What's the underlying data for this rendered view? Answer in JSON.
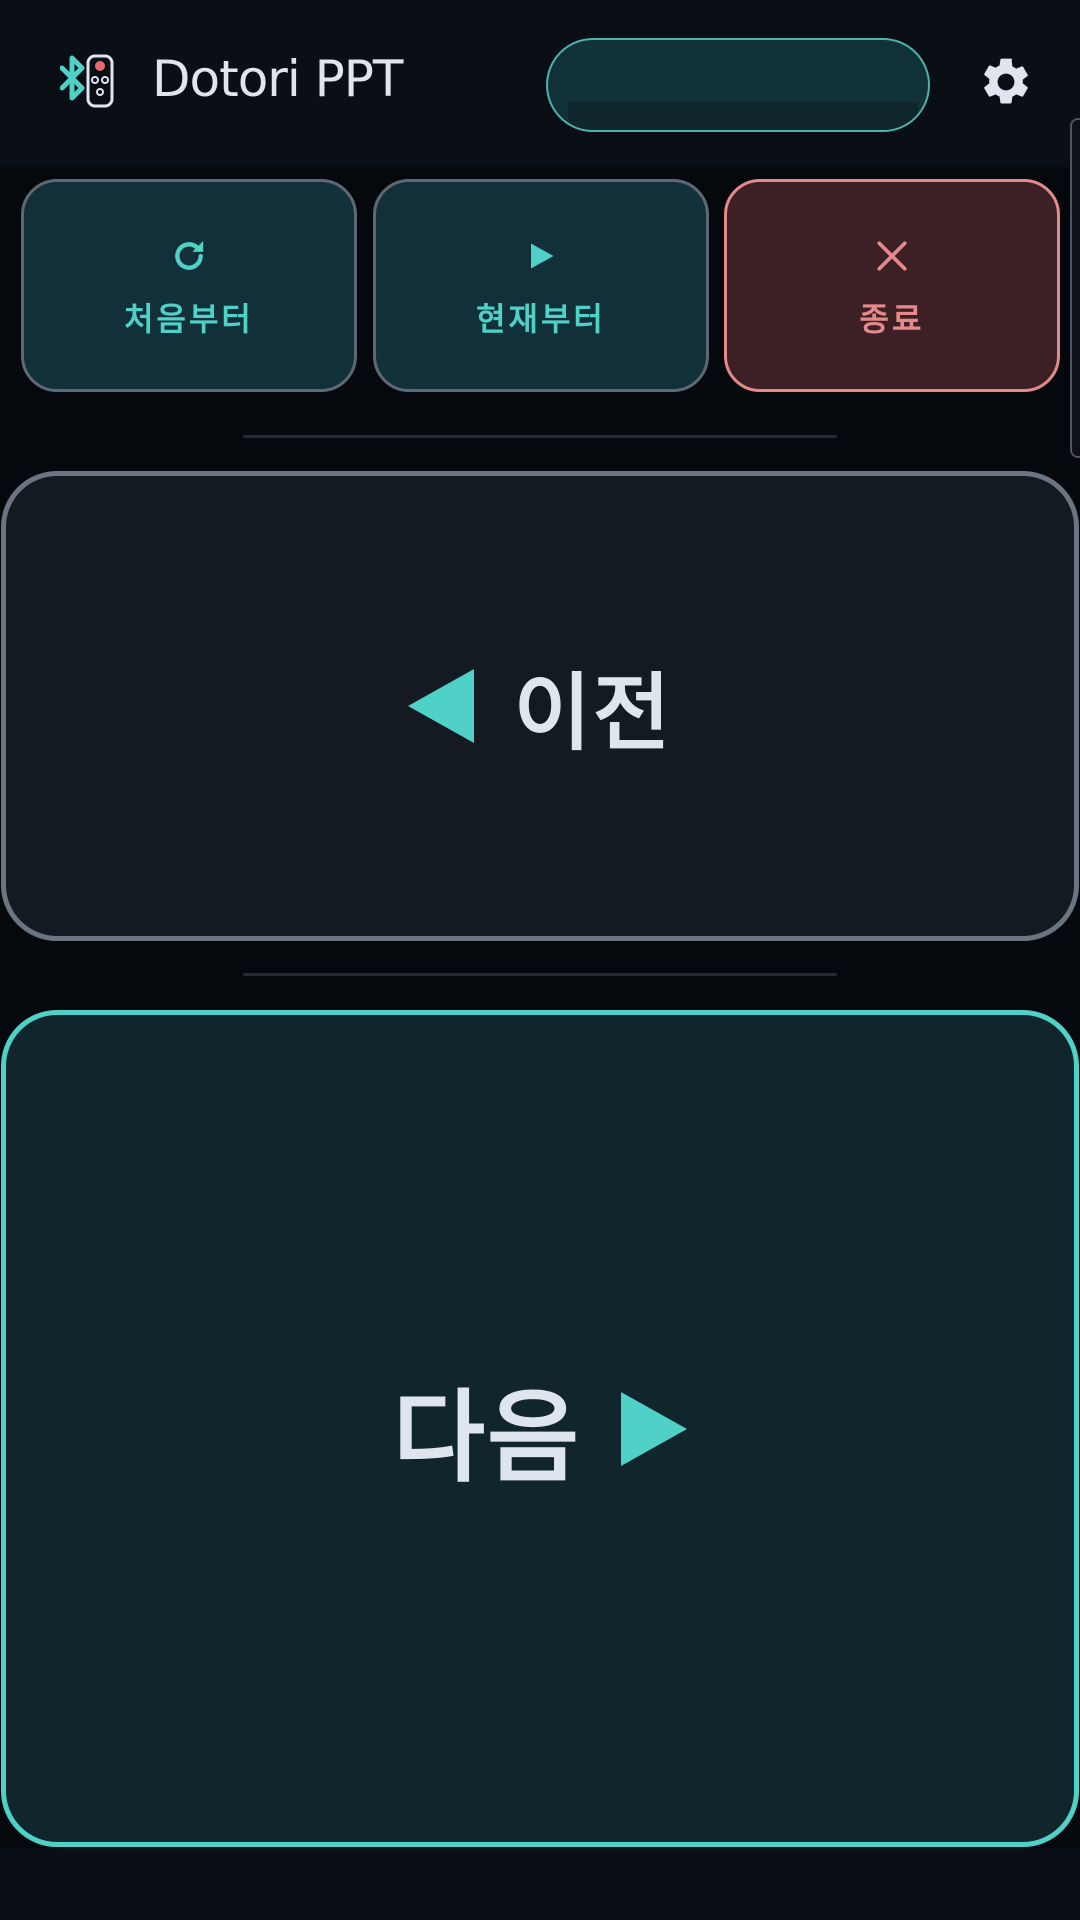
{
  "header": {
    "title": "Dotori PPT",
    "logo_icon": "bluetooth-remote-icon",
    "settings_icon": "gear-icon"
  },
  "controls": {
    "restart": {
      "label": "처음부터",
      "icon": "refresh-icon"
    },
    "current": {
      "label": "현재부터",
      "icon": "play-icon"
    },
    "exit": {
      "label": "종료",
      "icon": "close-icon"
    }
  },
  "navigation": {
    "prev_label": "이전",
    "next_label": "다음",
    "prev_icon": "triangle-left-icon",
    "next_icon": "triangle-right-icon"
  },
  "colors": {
    "accent": "#4fd1c7",
    "danger": "#e48a8a",
    "background": "#05080c",
    "text": "#dfe5ee"
  }
}
